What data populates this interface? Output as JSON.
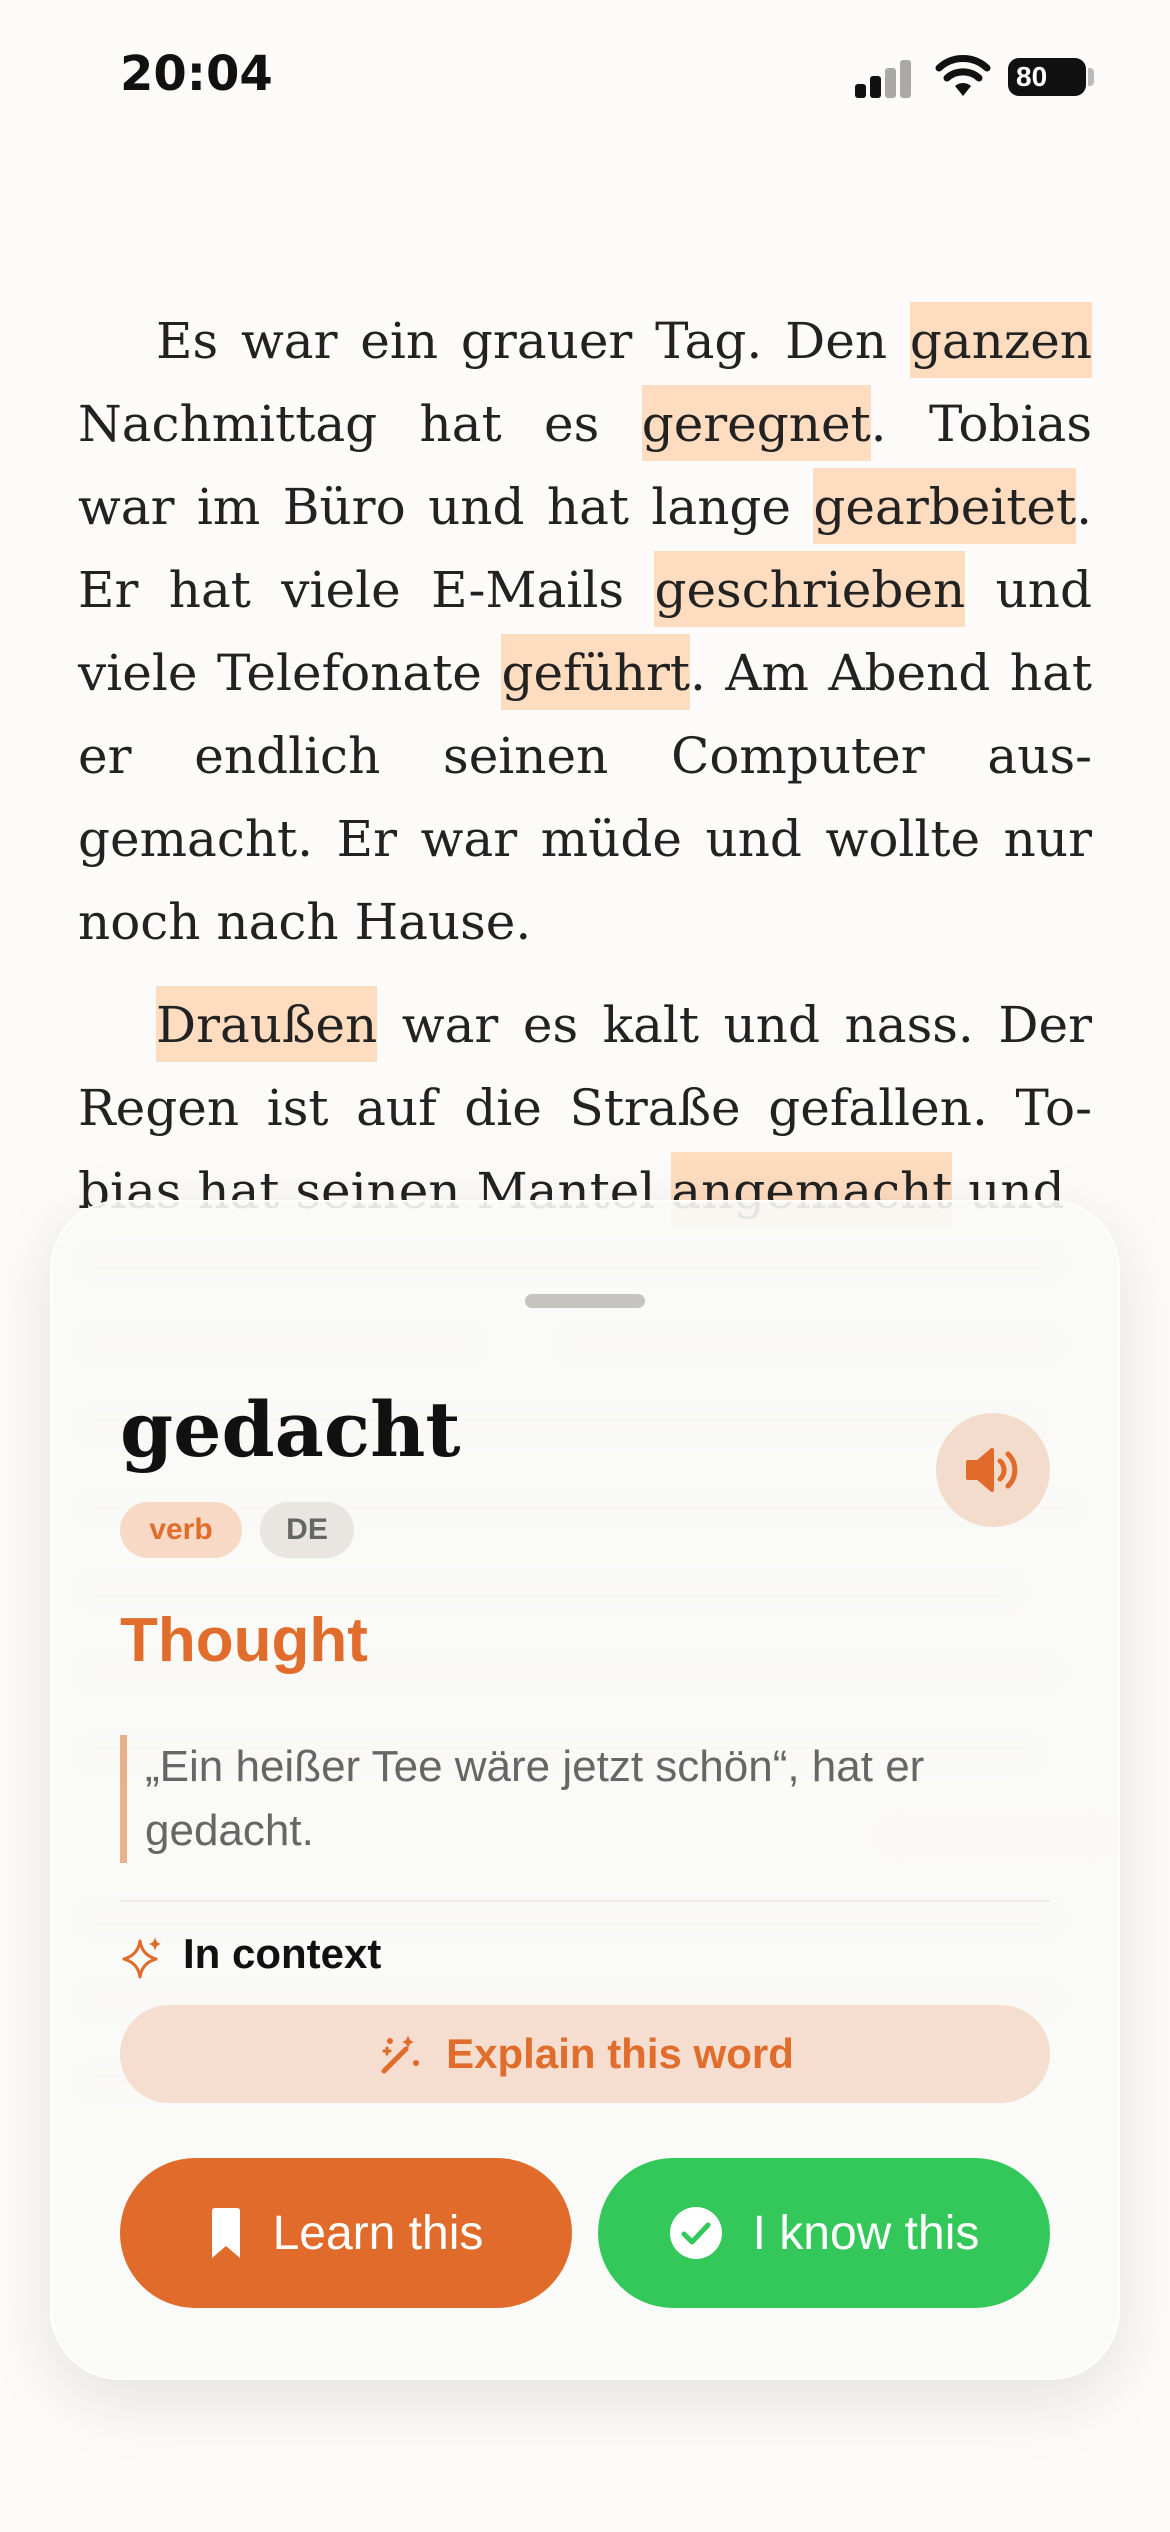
{
  "status_bar": {
    "time": "20:04",
    "battery": "80"
  },
  "reader": {
    "paragraphs": [
      [
        {
          "t": "Es war ein grauer Tag. Den "
        },
        {
          "t": "ganzen",
          "hl": true
        },
        {
          "t": " Nachmittag hat es "
        },
        {
          "t": "geregnet",
          "hl": true
        },
        {
          "t": ". Tobias war im Büro und hat lange "
        },
        {
          "t": "gearbeitet",
          "hl": true
        },
        {
          "t": ". Er hat viele E-Mails "
        },
        {
          "t": "geschrieben",
          "hl": true
        },
        {
          "t": " und viele Telefonate "
        },
        {
          "t": "geführt",
          "hl": true
        },
        {
          "t": ". Am Abend hat er endlich seinen Computer aus-gemacht. Er war müde und wollte nur noch nach Hause."
        }
      ],
      [
        {
          "t": "Draußen",
          "hl": true
        },
        {
          "t": " war es kalt und nass. Der Regen ist auf die Straße gefallen. To-bias hat seinen Mantel "
        },
        {
          "t": "angemacht",
          "hl": true
        },
        {
          "t": " und"
        }
      ]
    ]
  },
  "word_card": {
    "word": "gedacht",
    "part_of_speech": "verb",
    "language": "DE",
    "translation": "Thought",
    "example": "„Ein heißer Tee wäre jetzt schön“, hat er gedacht.",
    "context_label": "In context",
    "explain_label": "Explain this word",
    "learn_label": "Learn this",
    "know_label": "I know this",
    "icons": {
      "speaker": "speaker-icon",
      "sparkles": "sparkles-icon",
      "magic_wand": "magic-wand-icon",
      "bookmark": "bookmark-icon",
      "check": "checkmark-circle-icon"
    }
  },
  "colors": {
    "accent": "#e06b2a",
    "highlight": "#fddcc0",
    "success": "#34c759"
  }
}
